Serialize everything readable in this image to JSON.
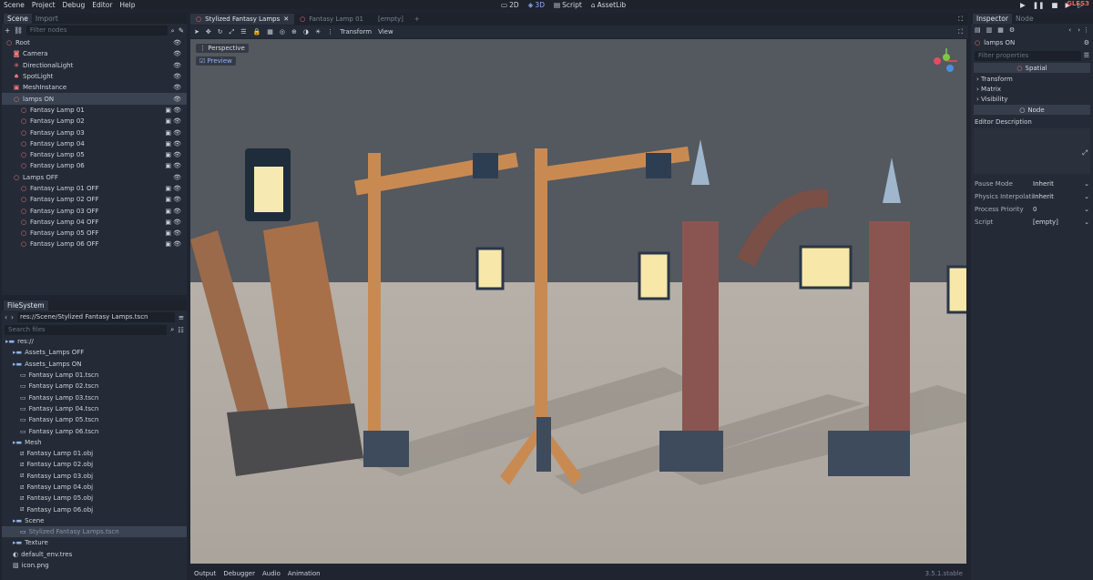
{
  "menubar": {
    "items": [
      "Scene",
      "Project",
      "Debug",
      "Editor",
      "Help"
    ],
    "modes": [
      "2D",
      "3D",
      "Script",
      "AssetLib"
    ],
    "active_mode": "3D",
    "renderer": "GLES3"
  },
  "scene_dock": {
    "tabs": [
      "Scene",
      "Import"
    ],
    "filter_placeholder": "Filter nodes",
    "tree": [
      {
        "label": "Root",
        "depth": 0,
        "icon": "node3d-icon",
        "color": "red"
      },
      {
        "label": "Camera",
        "depth": 1,
        "icon": "camera-icon",
        "color": "red"
      },
      {
        "label": "DirectionalLight",
        "depth": 1,
        "icon": "sun-icon",
        "color": "red"
      },
      {
        "label": "SpotLight",
        "depth": 1,
        "icon": "spotlight-icon",
        "color": "red"
      },
      {
        "label": "MeshInstance",
        "depth": 1,
        "icon": "mesh-icon",
        "color": "red"
      },
      {
        "label": "lamps ON",
        "depth": 1,
        "icon": "node3d-icon",
        "color": "red",
        "selected": true
      },
      {
        "label": "Fantasy Lamp 01",
        "depth": 2,
        "icon": "node3d-icon",
        "color": "red"
      },
      {
        "label": "Fantasy Lamp 02",
        "depth": 2,
        "icon": "node3d-icon",
        "color": "red"
      },
      {
        "label": "Fantasy Lamp 03",
        "depth": 2,
        "icon": "node3d-icon",
        "color": "red"
      },
      {
        "label": "Fantasy Lamp 04",
        "depth": 2,
        "icon": "node3d-icon",
        "color": "red"
      },
      {
        "label": "Fantasy Lamp 05",
        "depth": 2,
        "icon": "node3d-icon",
        "color": "red"
      },
      {
        "label": "Fantasy Lamp 06",
        "depth": 2,
        "icon": "node3d-icon",
        "color": "red"
      },
      {
        "label": "Lamps OFF",
        "depth": 1,
        "icon": "node3d-icon",
        "color": "red"
      },
      {
        "label": "Fantasy Lamp 01 OFF",
        "depth": 2,
        "icon": "node3d-icon",
        "color": "red"
      },
      {
        "label": "Fantasy Lamp 02 OFF",
        "depth": 2,
        "icon": "node3d-icon",
        "color": "red"
      },
      {
        "label": "Fantasy Lamp 03 OFF",
        "depth": 2,
        "icon": "node3d-icon",
        "color": "red"
      },
      {
        "label": "Fantasy Lamp 04 OFF",
        "depth": 2,
        "icon": "node3d-icon",
        "color": "red"
      },
      {
        "label": "Fantasy Lamp 05 OFF",
        "depth": 2,
        "icon": "node3d-icon",
        "color": "red"
      },
      {
        "label": "Fantasy Lamp 06 OFF",
        "depth": 2,
        "icon": "node3d-icon",
        "color": "red"
      }
    ]
  },
  "filesystem": {
    "tab": "FileSystem",
    "path": "res://Scene/Stylized Fantasy Lamps.tscn",
    "search_placeholder": "Search files",
    "tree": [
      {
        "label": "res://",
        "depth": 0,
        "kind": "folder"
      },
      {
        "label": "Assets_Lamps OFF",
        "depth": 1,
        "kind": "folder"
      },
      {
        "label": "Assets_Lamps ON",
        "depth": 1,
        "kind": "folder"
      },
      {
        "label": "Fantasy Lamp 01.tscn",
        "depth": 2,
        "kind": "scene"
      },
      {
        "label": "Fantasy Lamp 02.tscn",
        "depth": 2,
        "kind": "scene"
      },
      {
        "label": "Fantasy Lamp 03.tscn",
        "depth": 2,
        "kind": "scene"
      },
      {
        "label": "Fantasy Lamp 04.tscn",
        "depth": 2,
        "kind": "scene"
      },
      {
        "label": "Fantasy Lamp 05.tscn",
        "depth": 2,
        "kind": "scene"
      },
      {
        "label": "Fantasy Lamp 06.tscn",
        "depth": 2,
        "kind": "scene"
      },
      {
        "label": "Mesh",
        "depth": 1,
        "kind": "folder"
      },
      {
        "label": "Fantasy Lamp 01.obj",
        "depth": 2,
        "kind": "mesh"
      },
      {
        "label": "Fantasy Lamp 02.obj",
        "depth": 2,
        "kind": "mesh"
      },
      {
        "label": "Fantasy Lamp 03.obj",
        "depth": 2,
        "kind": "mesh"
      },
      {
        "label": "Fantasy Lamp 04.obj",
        "depth": 2,
        "kind": "mesh"
      },
      {
        "label": "Fantasy Lamp 05.obj",
        "depth": 2,
        "kind": "mesh"
      },
      {
        "label": "Fantasy Lamp 06.obj",
        "depth": 2,
        "kind": "mesh"
      },
      {
        "label": "Scene",
        "depth": 1,
        "kind": "folder"
      },
      {
        "label": "Stylized Fantasy Lamps.tscn",
        "depth": 2,
        "kind": "scene",
        "selected": true
      },
      {
        "label": "Texture",
        "depth": 1,
        "kind": "folder"
      },
      {
        "label": "default_env.tres",
        "depth": 1,
        "kind": "resource"
      },
      {
        "label": "icon.png",
        "depth": 1,
        "kind": "image"
      }
    ]
  },
  "viewport": {
    "tabs": [
      {
        "label": "Stylized Fantasy Lamps",
        "active": true
      },
      {
        "label": "Fantasy Lamp 01",
        "active": false
      },
      {
        "label": "[empty]",
        "active": false
      }
    ],
    "toolbar": {
      "transform": "Transform",
      "view": "View"
    },
    "perspective_label": "Perspective",
    "preview_label": "Preview"
  },
  "bottom_panel": {
    "tabs": [
      "Output",
      "Debugger",
      "Audio",
      "Animation"
    ],
    "version": "3.5.1.stable"
  },
  "inspector": {
    "tabs": [
      "Inspector",
      "Node"
    ],
    "node_name": "lamps ON",
    "filter_placeholder": "Filter properties",
    "spatial_section": "Spatial",
    "categories": [
      "Transform",
      "Matrix",
      "Visibility"
    ],
    "node_section": "Node",
    "editor_description": "Editor Description",
    "properties": [
      {
        "key": "Pause Mode",
        "value": "Inherit"
      },
      {
        "key": "Physics Interpolati",
        "value": "Inherit"
      },
      {
        "key": "Process Priority",
        "value": "0"
      },
      {
        "key": "Script",
        "value": "[empty]"
      }
    ]
  }
}
